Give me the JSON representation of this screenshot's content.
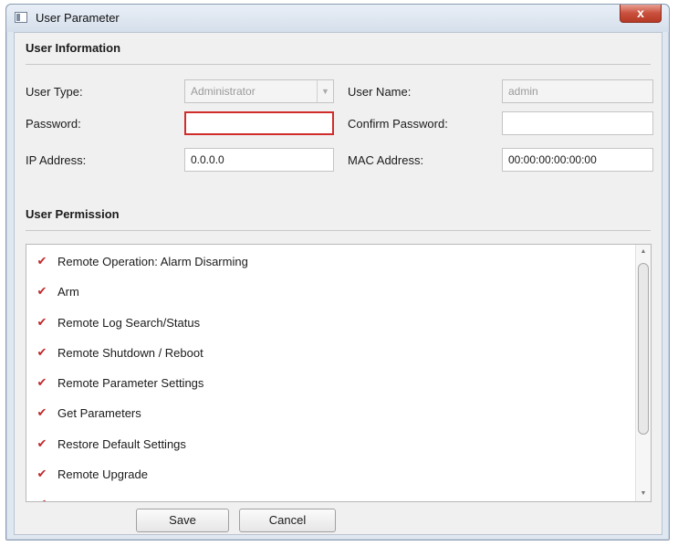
{
  "window": {
    "title": "User Parameter",
    "close_label": "x"
  },
  "user_info": {
    "section_title": "User Information",
    "user_type": {
      "label": "User Type:",
      "value": "Administrator"
    },
    "user_name": {
      "label": "User Name:",
      "value": "admin"
    },
    "password": {
      "label": "Password:",
      "value": ""
    },
    "confirm_password": {
      "label": "Confirm Password:",
      "value": ""
    },
    "ip_address": {
      "label": "IP Address:",
      "value": "0.0.0.0"
    },
    "mac_address": {
      "label": "MAC Address:",
      "value": "00:00:00:00:00:00"
    }
  },
  "permissions": {
    "section_title": "User Permission",
    "items": [
      {
        "label": "Remote Operation: Alarm Disarming",
        "checked": true
      },
      {
        "label": "Arm",
        "checked": true
      },
      {
        "label": "Remote Log Search/Status",
        "checked": true
      },
      {
        "label": "Remote Shutdown / Reboot",
        "checked": true
      },
      {
        "label": "Remote Parameter Settings",
        "checked": true
      },
      {
        "label": "Get Parameters",
        "checked": true
      },
      {
        "label": "Restore Default Settings",
        "checked": true
      },
      {
        "label": "Remote Upgrade",
        "checked": true
      }
    ]
  },
  "buttons": {
    "save": "Save",
    "cancel": "Cancel"
  },
  "colors": {
    "check_mark": "#c0282a",
    "error_border": "#d02c2c",
    "close_button": "#c9503c"
  }
}
